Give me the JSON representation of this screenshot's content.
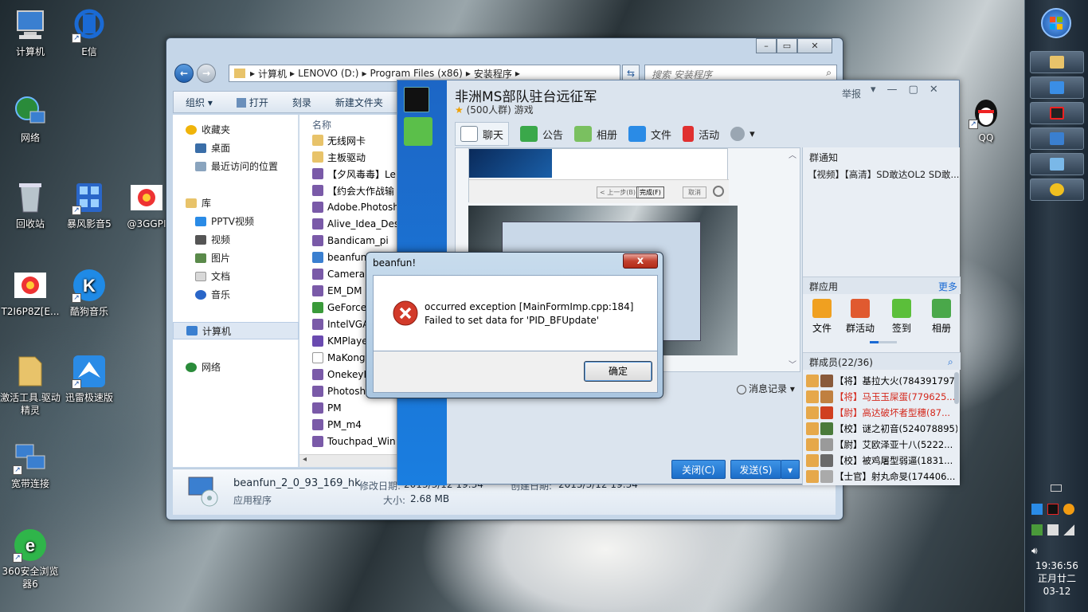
{
  "desktop": {
    "icons": [
      {
        "label": "计算机"
      },
      {
        "label": "E信"
      },
      {
        "label": "网络"
      },
      {
        "label": "回收站"
      },
      {
        "label": "暴风影音5"
      },
      {
        "label": "@3GGPI"
      },
      {
        "label": "T2I6P8Z[E..."
      },
      {
        "label": "酷狗音乐"
      },
      {
        "label": "激活工具.驱动精灵"
      },
      {
        "label": "迅雷极速版"
      },
      {
        "label": "宽带连接"
      },
      {
        "label": "360安全浏览器6"
      },
      {
        "label": "QQ"
      }
    ]
  },
  "taskbar": {
    "clock": {
      "time": "19:36:56",
      "lunar": "正月廿二",
      "date": "03-12"
    }
  },
  "explorer": {
    "breadcrumb": [
      "计算机",
      "LENOVO (D:)",
      "Program Files (x86)",
      "安装程序"
    ],
    "search_placeholder": "搜索 安装程序",
    "toolbar": [
      "组织 ▾",
      "打开",
      "刻录",
      "新建文件夹"
    ],
    "nav": {
      "favorites": "收藏夹",
      "desktop": "桌面",
      "recent": "最近访问的位置",
      "libraries": "库",
      "pptv": "PPTV视频",
      "videos": "视频",
      "pictures": "图片",
      "documents": "文档",
      "music": "音乐",
      "computer": "计算机",
      "network": "网络"
    },
    "column_name": "名称",
    "files": [
      "无线网卡",
      "主板驱动",
      "【夕风毒毒】Le",
      "【约会大作战输",
      "Adobe.Photosh",
      "Alive_Idea_Des",
      "Bandicam_pi",
      "beanfun",
      "Camera",
      "EM_DM",
      "GeForce",
      "IntelVGA",
      "KMPlaye",
      "MaKong",
      "OnekeyI",
      "Photoshop",
      "PM",
      "PM_m4",
      "Touchpad_Win"
    ],
    "details": {
      "name": "beanfun_2_0_93_169_hk",
      "modified_label": "修改日期:",
      "modified": "2013/3/12 19:34",
      "created_label": "创建日期:",
      "created": "2013/3/12 19:34",
      "type": "应用程序",
      "size_label": "大小:",
      "size": "2.68 MB"
    }
  },
  "qq": {
    "title": "非洲MS部队驻台远征军",
    "subtitle": "(500人群) 游戏",
    "report": "举报",
    "tabs": [
      "聊天",
      "公告",
      "相册",
      "文件",
      "活动"
    ],
    "wizard_buttons": [
      "< 上一步(B)",
      "完成(F)",
      "取消"
    ],
    "notice_header": "群通知",
    "notice_text": "【视频】【高清】SD敢达OL2 SD敢...",
    "apps_header": "群应用",
    "apps_more": "更多",
    "apps": [
      "文件",
      "群活动",
      "签到",
      "相册"
    ],
    "members_header": "群成员(22/36)",
    "members": [
      {
        "text": "【将】基拉大火(784391797)",
        "color": "#000000"
      },
      {
        "text": "【将】马玉玉屎蛋(779625...",
        "color": "#d4281c"
      },
      {
        "text": "【尉】高达破坏者型穗(87...",
        "color": "#d4281c"
      },
      {
        "text": "【校】谜之初音(524078895)",
        "color": "#000000"
      },
      {
        "text": "【尉】艾欧泽亚十八(5222...",
        "color": "#000000"
      },
      {
        "text": "【校】被鸡屠型弱逼(1831...",
        "color": "#000000"
      },
      {
        "text": "【士官】射丸命旻(174406...",
        "color": "#000000"
      }
    ],
    "history": "消息记录",
    "close_btn": "关闭(C)",
    "send_btn": "发送(S)"
  },
  "dialog": {
    "title": "beanfun!",
    "line1": "occurred exception [MainFormImp.cpp:184]",
    "line2": "Failed to set data for 'PID_BFUpdate'",
    "ok": "确定",
    "close": "x"
  }
}
